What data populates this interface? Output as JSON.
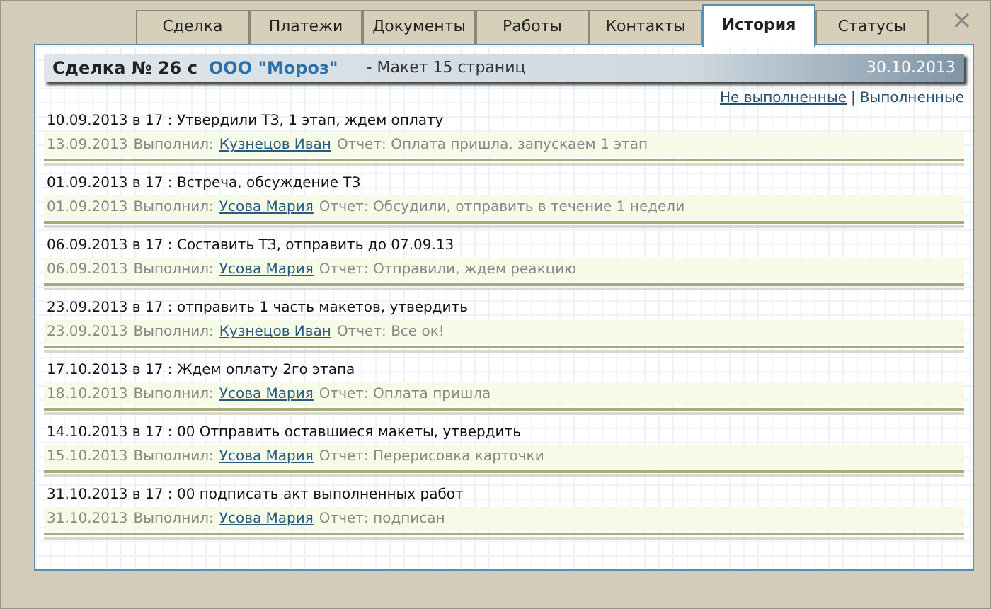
{
  "tabs": [
    {
      "label": "Сделка",
      "selected": false
    },
    {
      "label": "Платежи",
      "selected": false
    },
    {
      "label": "Документы",
      "selected": false
    },
    {
      "label": "Работы",
      "selected": false
    },
    {
      "label": "Контакты",
      "selected": false
    },
    {
      "label": "История",
      "selected": true
    },
    {
      "label": "Статусы",
      "selected": false
    }
  ],
  "close": "×",
  "header": {
    "title": "Сделка № 26 с",
    "client": "ООО \"Мороз\"",
    "subject": "- Макет 15 страниц",
    "date": "30.10.2013"
  },
  "filters": [
    {
      "label": "Не выполненные"
    },
    {
      "label": "Выполненные"
    }
  ],
  "filter_separator": "|",
  "entries": [
    {
      "task": "10.09.2013 в 17 : Утвердили ТЗ, 1 этап, ждем оплату",
      "done_date": "13.09.2013",
      "done_label": "Выполнил:",
      "person": "Кузнецов Иван",
      "report": "Отчет: Оплата пришла, запускаем 1 этап"
    },
    {
      "task": "01.09.2013 в 17 : Встреча, обсуждение ТЗ",
      "done_date": "01.09.2013",
      "done_label": "Выполнил:",
      "person": "Усова Мария",
      "report": "Отчет: Обсудили, отправить в течение 1 недели"
    },
    {
      "task": "06.09.2013 в 17 : Составить ТЗ, отправить до 07.09.13",
      "done_date": "06.09.2013",
      "done_label": "Выполнил:",
      "person": "Усова Мария",
      "report": "Отчет: Отправили, ждем реакцию"
    },
    {
      "task": "23.09.2013 в 17 : отправить 1 часть макетов, утвердить",
      "done_date": "23.09.2013",
      "done_label": "Выполнил:",
      "person": "Кузнецов Иван",
      "report": "Отчет: Все ок!"
    },
    {
      "task": "17.10.2013 в 17 : Ждем оплату 2го этапа",
      "done_date": "18.10.2013",
      "done_label": "Выполнил:",
      "person": "Усова Мария",
      "report": "Отчет: Оплата пришла"
    },
    {
      "task": "14.10.2013 в 17 : 00 Отправить оставшиеся макеты, утвердить",
      "done_date": "15.10.2013",
      "done_label": "Выполнил:",
      "person": "Усова Мария",
      "report": "Отчет: Перерисовка карточки"
    },
    {
      "task": "31.10.2013 в 17 : 00 подписать акт выполненных работ",
      "done_date": "31.10.2013",
      "done_label": "Выполнил:",
      "person": "Усова Мария",
      "report": "Отчет: подписан"
    }
  ]
}
